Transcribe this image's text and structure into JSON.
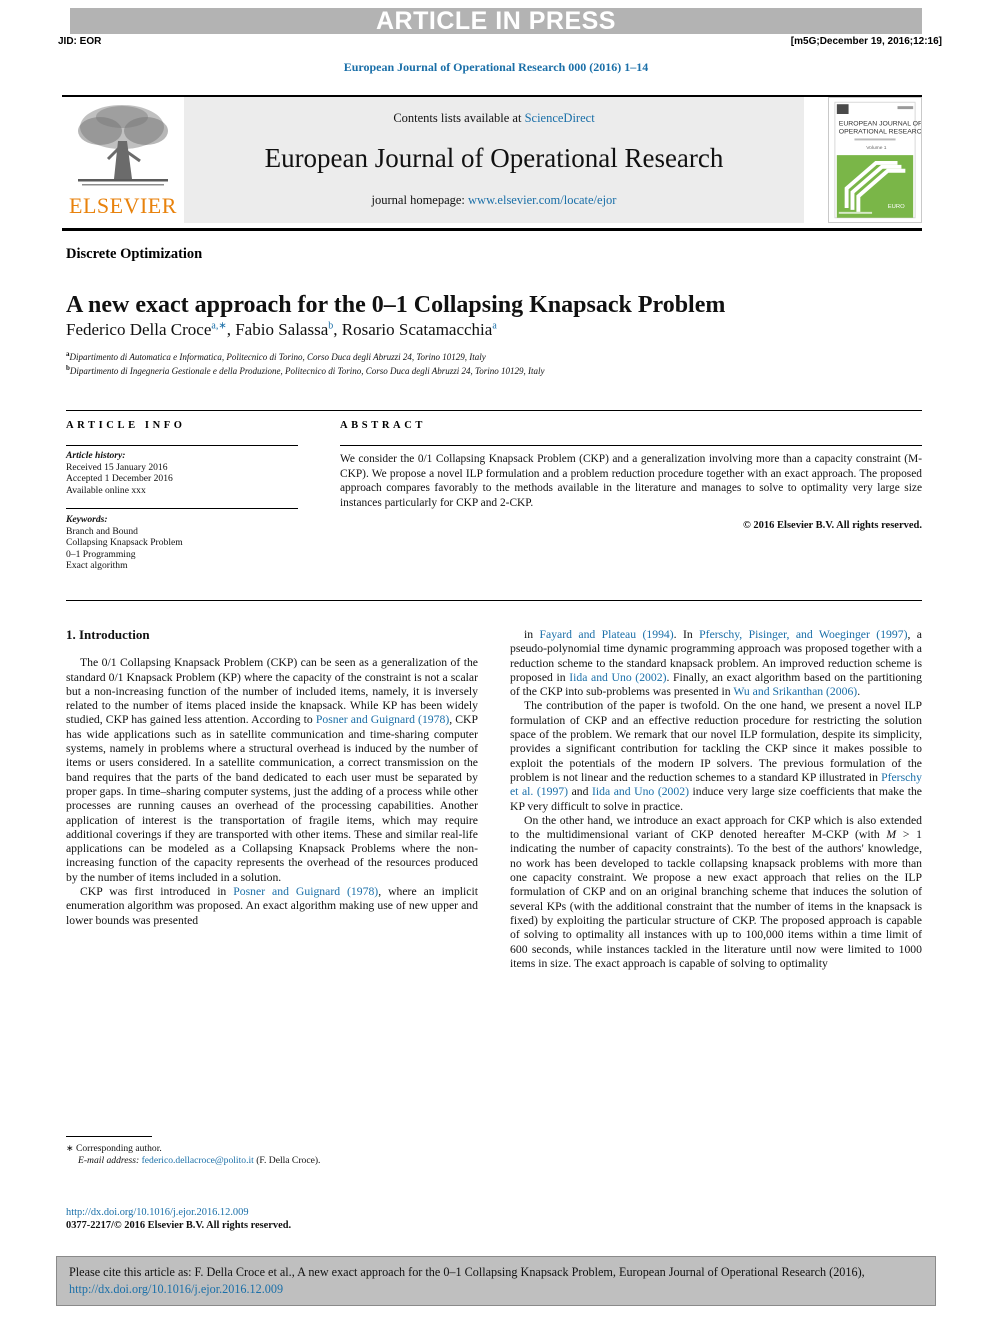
{
  "banner": {
    "text": "ARTICLE IN PRESS",
    "jid": "JID: EOR",
    "stamp": "[m5G;December 19, 2016;12:16]"
  },
  "runningHead": "European Journal of Operational Research 000 (2016) 1–14",
  "masthead": {
    "publisher": "ELSEVIER",
    "contents_prefix": "Contents lists available at ",
    "contents_link": "ScienceDirect",
    "journal": "European Journal of Operational Research",
    "homepage_prefix": "journal homepage: ",
    "homepage_link": "www.elsevier.com/locate/ejor",
    "cover_title_line1": "EUROPEAN JOURNAL OF",
    "cover_title_line2": "OPERATIONAL RESEARCH",
    "cover_volume": "Volume 1",
    "cover_footer": "EURO"
  },
  "article": {
    "kicker": "Discrete Optimization",
    "title": "A new exact approach for the 0–1 Collapsing Knapsack Problem",
    "authors": [
      {
        "name": "Federico Della Croce",
        "sup": "a,∗"
      },
      {
        "name": "Fabio Salassa",
        "sup": "b"
      },
      {
        "name": "Rosario Scatamacchia",
        "sup": "a"
      }
    ],
    "affiliations": [
      {
        "mark": "a",
        "text": "Dipartimento di Automatica e Informatica, Politecnico di Torino, Corso Duca degli Abruzzi 24, Torino 10129, Italy"
      },
      {
        "mark": "b",
        "text": "Dipartimento di Ingegneria Gestionale e della Produzione, Politecnico di Torino, Corso Duca degli Abruzzi 24, Torino 10129, Italy"
      }
    ]
  },
  "info": {
    "heading": "ARTICLE INFO",
    "history_label": "Article history:",
    "history": [
      "Received 15 January 2016",
      "Accepted 1 December 2016",
      "Available online xxx"
    ],
    "keywords_label": "Keywords:",
    "keywords": [
      "Branch and Bound",
      "Collapsing Knapsack Problem",
      "0–1 Programming",
      "Exact algorithm"
    ]
  },
  "abstract": {
    "heading": "ABSTRACT",
    "text": "We consider the 0/1 Collapsing Knapsack Problem (CKP) and a generalization involving more than a capacity constraint (M-CKP). We propose a novel ILP formulation and a problem reduction procedure together with an exact approach. The proposed approach compares favorably to the methods available in the literature and manages to solve to optimality very large size instances particularly for CKP and 2-CKP.",
    "copyright": "© 2016 Elsevier B.V. All rights reserved."
  },
  "body": {
    "section_heading": "1. Introduction",
    "left": {
      "p1_a": "The 0/1 Collapsing Knapsack Problem (CKP) can be seen as a generalization of the standard 0/1 Knapsack Problem (KP) where the capacity of the constraint is not a scalar but a non-increasing function of the number of included items, namely, it is inversely related to the number of items placed inside the knapsack. While KP has been widely studied, CKP has gained less attention. According to ",
      "p1_ref": "Posner and Guignard (1978)",
      "p1_b": ", CKP has wide applications such as in satellite communication and time-sharing computer systems, namely in problems where a structural overhead is induced by the number of items or users considered. In a satellite communication, a correct transmission on the band requires that the parts of the band dedicated to each user must be separated by proper gaps. In time–sharing computer systems, just the adding of a process while other processes are running causes an overhead of the processing capabilities. Another application of interest is the transportation of fragile items, which may require additional coverings if they are transported with other items. These and similar real-life applications can be modeled as a Collapsing Knapsack Problems where the non-increasing function of the capacity represents the overhead of the resources produced by the number of items included in a solution.",
      "p2_a": "CKP was first introduced in ",
      "p2_ref": "Posner and Guignard (1978)",
      "p2_b": ", where an implicit enumeration algorithm was proposed. An exact algorithm making use of new upper and lower bounds was presented"
    },
    "right": {
      "p1_a": "in ",
      "p1_ref1": "Fayard and Plateau (1994)",
      "p1_b": ". In ",
      "p1_ref2": "Pferschy, Pisinger, and Woeginger (1997)",
      "p1_c": ", a pseudo-polynomial time dynamic programming approach was proposed together with a reduction scheme to the standard knapsack problem. An improved reduction scheme is proposed in ",
      "p1_ref3": "Iida and Uno (2002)",
      "p1_d": ". Finally, an exact algorithm based on the partitioning of the CKP into sub-problems was presented in ",
      "p1_ref4": "Wu and Srikanthan (2006)",
      "p1_e": ".",
      "p2_a": "The contribution of the paper is twofold. On the one hand, we present a novel ILP formulation of CKP and an effective reduction procedure for restricting the solution space of the problem. We remark that our novel ILP formulation, despite its simplicity, provides a significant contribution for tackling the CKP since it makes possible to exploit the potentials of the modern IP solvers. The previous formulation of the problem is not linear and the reduction schemes to a standard KP illustrated in ",
      "p2_ref1": "Pferschy et al. (1997)",
      "p2_b": " and ",
      "p2_ref2": "Iida and Uno (2002)",
      "p2_c": " induce very large size coefficients that make the KP very difficult to solve in practice.",
      "p3_a": "On the other hand, we introduce an exact approach for CKP which is also extended to the multidimensional variant of CKP denoted hereafter M-CKP (with ",
      "p3_em": "M",
      "p3_b": " > 1 indicating the number of capacity constraints). To the best of the authors' knowledge, no work has been developed to tackle collapsing knapsack problems with more than one capacity constraint. We propose a new exact approach that relies on the ILP formulation of CKP and on an original branching scheme that induces the solution of several KPs (with the additional constraint that the number of items in the knapsack is fixed) by exploiting the particular structure of CKP. The proposed approach is capable of solving to optimality all instances with up to 100,000 items within a time limit of 600 seconds, while instances tackled in the literature until now were limited to 1000 items in size. The exact approach is capable of solving to optimality"
    }
  },
  "footnote": {
    "star": "∗",
    "corresponding": "Corresponding author.",
    "email_label": "E-mail address:",
    "email": "federico.dellacroce@polito.it",
    "email_owner": "(F. Della Croce)."
  },
  "doi_block": {
    "doi": "http://dx.doi.org/10.1016/j.ejor.2016.12.009",
    "issn_line": "0377-2217/© 2016 Elsevier B.V. All rights reserved."
  },
  "citation": {
    "text_a": "Please cite this article as: F. Della Croce et al., A new exact approach for the 0–1 Collapsing Knapsack Problem, European Journal of Operational Research (2016), ",
    "link": "http://dx.doi.org/10.1016/j.ejor.2016.12.009"
  },
  "colors": {
    "link": "#1a6fa8",
    "banner_bg": "#b3b3b3",
    "masthead_bg": "#ececec",
    "elsevier_orange": "#e8820c",
    "citation_bg": "#bfbfbf",
    "cover_green": "#7ab648"
  }
}
